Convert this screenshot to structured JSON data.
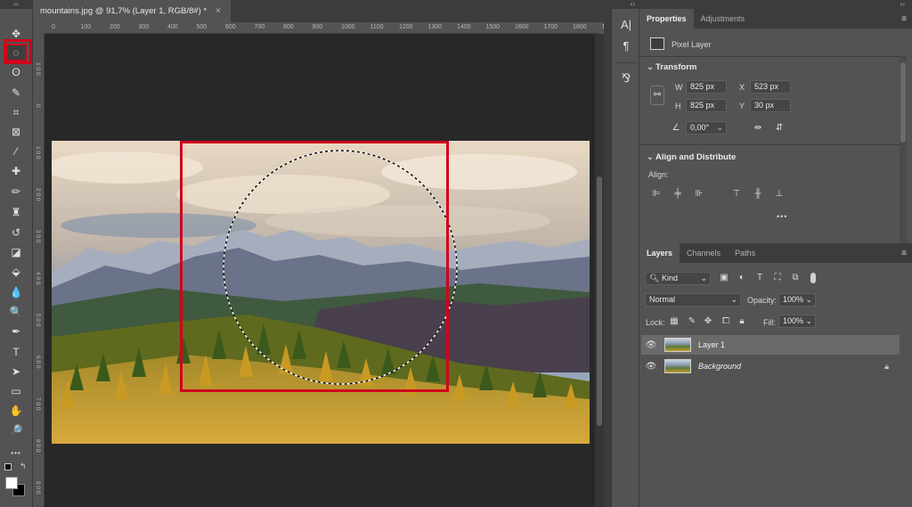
{
  "document": {
    "tab_title": "mountains.jpg @ 91,7% (Layer 1, RGB/8#) *",
    "close_glyph": "×",
    "ruler_top_ticks": [
      "0",
      "100",
      "200",
      "300",
      "400",
      "500",
      "600",
      "700",
      "800",
      "900",
      "1000",
      "1100",
      "1200",
      "1300",
      "1400",
      "1500",
      "1600",
      "1700",
      "1800",
      "190"
    ],
    "ruler_left_ticks": [
      "1 0 0",
      "0",
      "1 0 0",
      "2 0 0",
      "3 0 0",
      "4 0 0",
      "5 0 0",
      "6 0 0",
      "7 0 0",
      "8 0 0",
      "9 0 0"
    ]
  },
  "toolbar": {
    "collapse_glyph": "‹‹",
    "tools": [
      {
        "name": "move-tool",
        "icon": "move-icon",
        "glyph": "✥"
      },
      {
        "name": "elliptical-marquee-tool",
        "icon": "elliptical-marquee-icon",
        "glyph": "◌",
        "active": true
      },
      {
        "name": "lasso-tool",
        "icon": "lasso-icon",
        "glyph": "ʘ"
      },
      {
        "name": "quick-selection-tool",
        "icon": "quick-selection-icon",
        "glyph": "✎"
      },
      {
        "name": "crop-tool",
        "icon": "crop-icon",
        "glyph": "⌗"
      },
      {
        "name": "frame-tool",
        "icon": "frame-icon",
        "glyph": "⊠"
      },
      {
        "name": "eyedropper-tool",
        "icon": "eyedropper-icon",
        "glyph": "⁄"
      },
      {
        "name": "spot-healing-tool",
        "icon": "bandage-icon",
        "glyph": "✚"
      },
      {
        "name": "brush-tool",
        "icon": "brush-icon",
        "glyph": "✏"
      },
      {
        "name": "clone-stamp-tool",
        "icon": "stamp-icon",
        "glyph": "♜"
      },
      {
        "name": "history-brush-tool",
        "icon": "history-brush-icon",
        "glyph": "↺"
      },
      {
        "name": "eraser-tool",
        "icon": "eraser-icon",
        "glyph": "◪"
      },
      {
        "name": "paint-bucket-tool",
        "icon": "paint-bucket-icon",
        "glyph": "⬙"
      },
      {
        "name": "blur-tool",
        "icon": "drop-icon",
        "glyph": "💧"
      },
      {
        "name": "dodge-tool",
        "icon": "dodge-icon",
        "glyph": "🔍"
      },
      {
        "name": "pen-tool",
        "icon": "pen-icon",
        "glyph": "✒"
      },
      {
        "name": "type-tool",
        "icon": "type-icon",
        "glyph": "T"
      },
      {
        "name": "path-selection-tool",
        "icon": "arrow-icon",
        "glyph": "➤"
      },
      {
        "name": "rectangle-tool",
        "icon": "rectangle-icon",
        "glyph": "▭"
      },
      {
        "name": "hand-tool",
        "icon": "hand-icon",
        "glyph": "✋"
      },
      {
        "name": "zoom-tool",
        "icon": "zoom-icon",
        "glyph": "🔎"
      },
      {
        "name": "more-tools",
        "icon": "ellipsis-icon",
        "glyph": "•••"
      }
    ],
    "colors": {
      "foreground": "#ffffff",
      "background": "#000000"
    }
  },
  "midpanel": {
    "collapse_glyph": "‹‹",
    "icons": [
      {
        "name": "character-panel-button",
        "icon": "character-icon",
        "glyph": "A|"
      },
      {
        "name": "paragraph-panel-button",
        "icon": "paragraph-icon",
        "glyph": "¶"
      },
      {
        "name": "glyphs-panel-button",
        "icon": "glyphs-icon",
        "glyph": "⅋"
      }
    ]
  },
  "properties": {
    "collapse_glyph": "››",
    "tabs": [
      "Properties",
      "Adjustments"
    ],
    "menu_glyph": "≡",
    "layer_type": "Pixel Layer",
    "transform_title": "Transform",
    "w_label": "W",
    "w_value": "825 px",
    "h_label": "H",
    "h_value": "825 px",
    "x_label": "X",
    "x_value": "523 px",
    "y_label": "Y",
    "y_value": "30 px",
    "angle_value": "0,00°",
    "align_title": "Align and Distribute",
    "align_label": "Align:",
    "more_glyph": "•••"
  },
  "layers": {
    "tabs": [
      "Layers",
      "Channels",
      "Paths"
    ],
    "menu_glyph": "≡",
    "filter_kind": "Kind",
    "blend_mode": "Normal",
    "opacity_label": "Opacity:",
    "opacity_value": "100%",
    "lock_label": "Lock:",
    "fill_label": "Fill:",
    "fill_value": "100%",
    "items": [
      {
        "name": "Layer 1",
        "selected": true,
        "locked": false
      },
      {
        "name": "Background",
        "selected": false,
        "locked": true
      }
    ]
  },
  "colors": {
    "highlight": "#d0021b",
    "panel_bg": "#535353",
    "canvas_bg": "#282828"
  }
}
